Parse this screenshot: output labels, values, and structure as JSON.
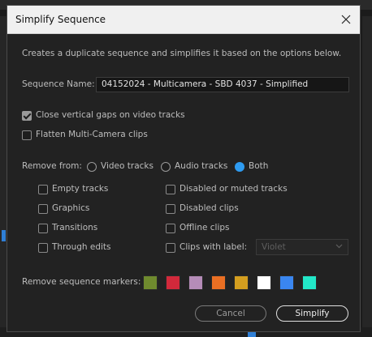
{
  "dialog": {
    "title": "Simplify Sequence",
    "description": "Creates a duplicate sequence and simplifies it based on the options below.",
    "sequence_name_label": "Sequence Name:",
    "sequence_name_value": "04152024 - Multicamera - SBD 4037 - Simplified",
    "options": {
      "close_gaps": {
        "label": "Close vertical gaps on video tracks",
        "checked": true
      },
      "flatten_multicam": {
        "label": "Flatten Multi-Camera clips",
        "checked": false
      }
    },
    "remove_from": {
      "label": "Remove from:",
      "choices": [
        "Video tracks",
        "Audio tracks",
        "Both"
      ],
      "selected": "Both"
    },
    "checkboxes_left": [
      "Empty tracks",
      "Graphics",
      "Transitions",
      "Through edits"
    ],
    "checkboxes_right": [
      "Disabled or muted tracks",
      "Disabled clips",
      "Offline clips",
      "Clips with label:"
    ],
    "label_select_value": "Violet",
    "markers": {
      "label": "Remove sequence markers:",
      "colors": [
        "#6f8a2e",
        "#d2293b",
        "#b58cb8",
        "#ea6f23",
        "#d49e1f",
        "#ffffff",
        "#3a86f0",
        "#22e7c8"
      ]
    },
    "buttons": {
      "cancel": "Cancel",
      "primary": "Simplify"
    }
  }
}
